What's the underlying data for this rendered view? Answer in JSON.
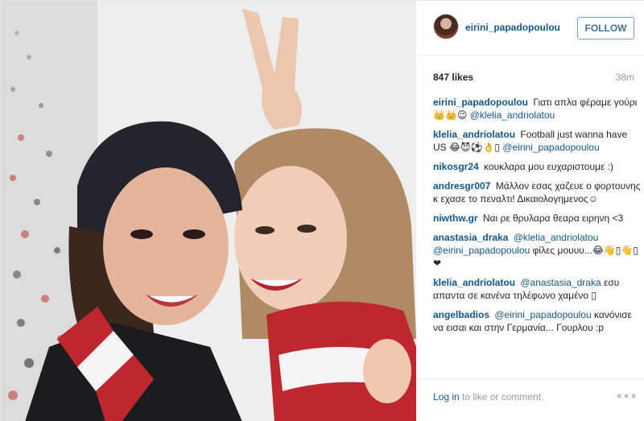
{
  "post": {
    "author": "eirini_papadopoulou",
    "follow_label": "FOLLOW",
    "likes": "847 likes",
    "time": "38m",
    "login_link": "Log in",
    "login_rest": " to like or comment."
  },
  "comments": [
    {
      "author": "eirini_papadopoulou",
      "text": "Γιατι απλα φέραμε γούρι 👑👑😉 ",
      "mention": "@klelia_andriolatou"
    },
    {
      "author": "klelia_andriolatou",
      "text": "Football just wanna have US 😂😈⚽👌▯ ",
      "mention": "@eirini_papadopoulou"
    },
    {
      "author": "nikosgr24",
      "text": "κουκλαρα μου ευχαριστουμε :)",
      "mention": ""
    },
    {
      "author": "andresgr007",
      "text": "Μάλλον εσας χαζευε ο φορτουνης κ εχασε το πεναλτι! Δικαιολογημενος☺",
      "mention": ""
    },
    {
      "author": "niwthw.gr",
      "text": "Ναι ρε θρυλαρα θεαρα ειρηνη <3",
      "mention": ""
    },
    {
      "author": "anastasia_draka",
      "text": "",
      "mention": "@klelia_andriolatou @eirini_papadopoulou",
      "text_after": " φίλες μουυυ...😂👋▯👋▯❤"
    },
    {
      "author": "klelia_andriolatou",
      "text": "",
      "mention": "@anastasia_draka",
      "text_after": " εσυ απαντα σε κανένα τηλέφωνο χαμένο ▯"
    },
    {
      "author": "angelbadios",
      "text": "",
      "mention": "@eirini_papadopoulou",
      "text_after": " κανόνισε να εισαι και στην Γερμανία... Γουρλου :p"
    }
  ],
  "icons": {
    "avatar": "profile-photo",
    "more": "more-options-icon"
  },
  "colors": {
    "link": "#125688",
    "follow_border": "#6fa0c8",
    "muted": "#999999"
  }
}
